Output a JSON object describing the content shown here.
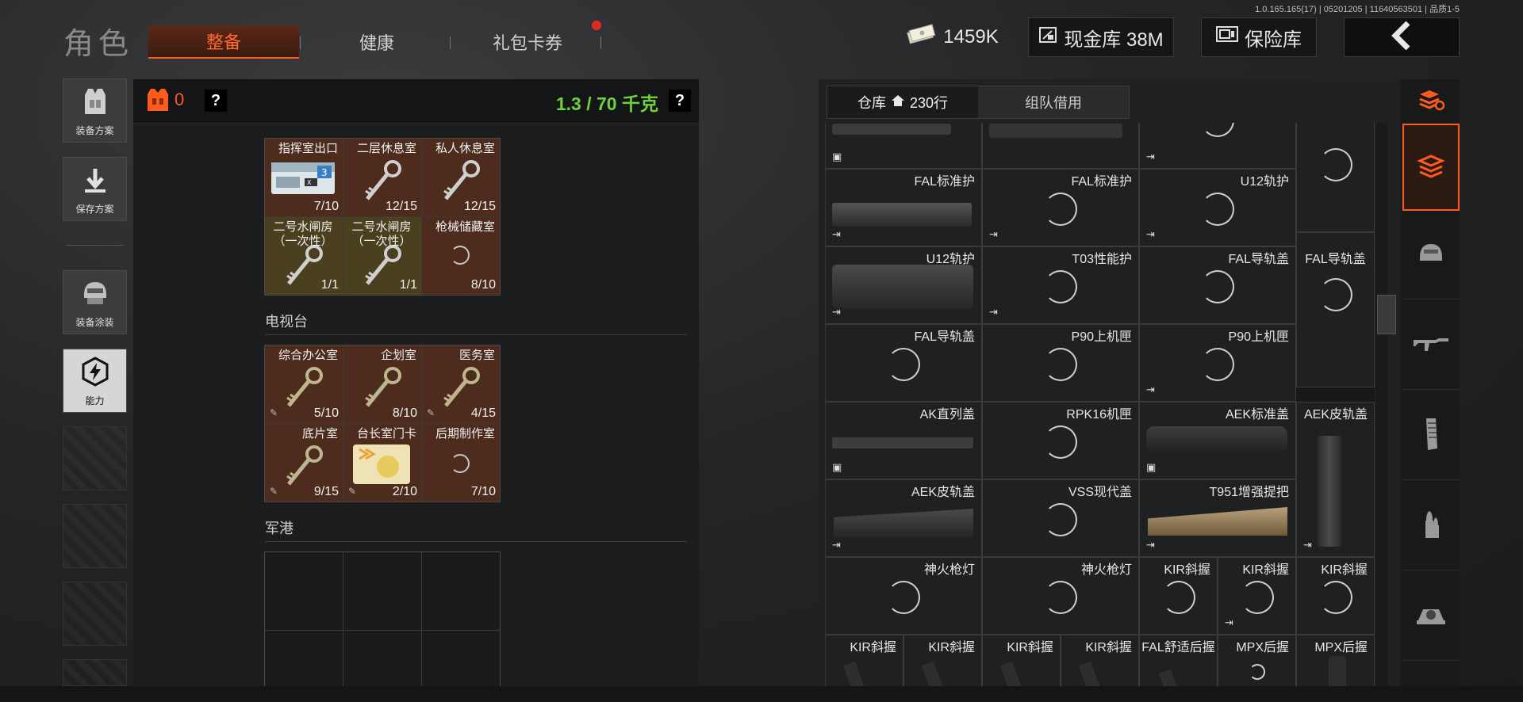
{
  "version": "1.0.165.165(17) | 05201205 | 11640563501 | 品质1-5",
  "header": {
    "title": "角色",
    "tabs": [
      {
        "label": "整备"
      },
      {
        "label": "健康"
      },
      {
        "label": "礼包卡券"
      }
    ],
    "currency": "1459K",
    "vault_label": "现金库 38M",
    "safe_label": "保险库"
  },
  "sidebar": {
    "items": [
      {
        "label": "装备方案"
      },
      {
        "label": "保存方案"
      },
      {
        "label": "装备涂装"
      },
      {
        "label": "能力"
      }
    ]
  },
  "loadout": {
    "armor_count": "0",
    "weight": "1.3 / 70 千克"
  },
  "key_sections": [
    {
      "title": "",
      "cells": [
        {
          "name": "指挥室出口",
          "count": "7/10"
        },
        {
          "name": "二层休息室",
          "count": "12/15"
        },
        {
          "name": "私人休息室",
          "count": "12/15"
        },
        {
          "name": "二号水闸房（一次性）",
          "count": "1/1"
        },
        {
          "name": "二号水闸房（一次性）",
          "count": "1/1"
        },
        {
          "name": "枪械储藏室",
          "count": "8/10"
        }
      ]
    },
    {
      "title": "电视台",
      "cells": [
        {
          "name": "综合办公室",
          "count": "5/10"
        },
        {
          "name": "企划室",
          "count": "8/10"
        },
        {
          "name": "医务室",
          "count": "4/15"
        },
        {
          "name": "底片室",
          "count": "9/15"
        },
        {
          "name": "台长室门卡",
          "count": "2/10"
        },
        {
          "name": "后期制作室",
          "count": "7/10"
        }
      ]
    },
    {
      "title": "军港",
      "cells": []
    }
  ],
  "warehouse": {
    "tab_storage": "仓库",
    "rows": "230行",
    "tab_team": "组队借用",
    "items": [
      {
        "name": "FAL标准护"
      },
      {
        "name": "FAL标准护"
      },
      {
        "name": "U12轨护"
      },
      {
        "name": "U12轨护"
      },
      {
        "name": "T03性能护"
      },
      {
        "name": "FAL导轨盖"
      },
      {
        "name": "FAL导轨盖"
      },
      {
        "name": "FAL导轨盖"
      },
      {
        "name": "P90上机匣"
      },
      {
        "name": "P90上机匣"
      },
      {
        "name": "AK直列盖"
      },
      {
        "name": "RPK16机匣"
      },
      {
        "name": "AEK标准盖"
      },
      {
        "name": "AEK皮轨盖"
      },
      {
        "name": "AEK皮轨盖"
      },
      {
        "name": "VSS现代盖"
      },
      {
        "name": "T951增强提把"
      },
      {
        "name": "神火枪灯"
      },
      {
        "name": "神火枪灯"
      },
      {
        "name": "KIR斜握"
      },
      {
        "name": "KIR斜握"
      },
      {
        "name": "KIR斜握"
      },
      {
        "name": "KIR斜握"
      },
      {
        "name": "KIR斜握"
      },
      {
        "name": "KIR斜握"
      },
      {
        "name": "KIR斜握"
      },
      {
        "name": "FAL舒适后握"
      },
      {
        "name": "MPX后握"
      },
      {
        "name": "MPX后握"
      }
    ]
  },
  "colors": {
    "accent": "#ff5a1f",
    "weight_green": "#6fd23a",
    "key_brown": "#4e2c1d",
    "key_olive": "#4a4020"
  }
}
